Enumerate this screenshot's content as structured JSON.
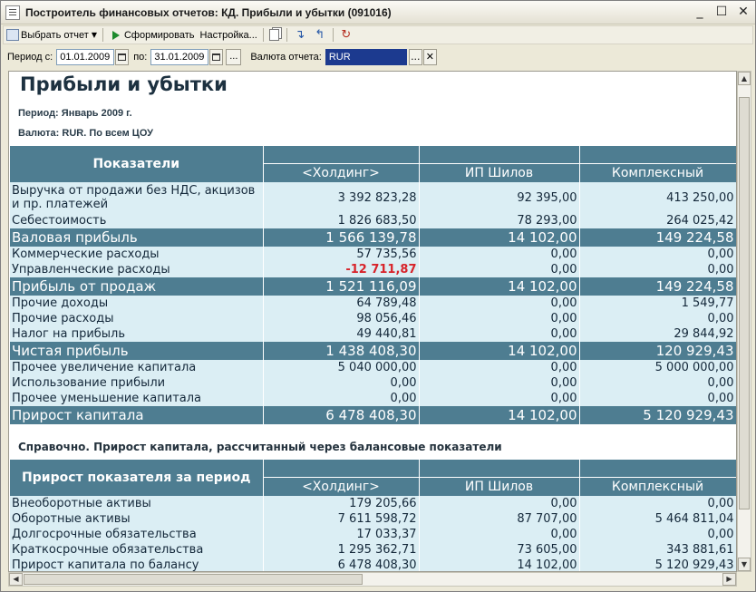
{
  "window": {
    "title": "Построитель финансовых отчетов: КД. Прибыли и убытки (091016)",
    "buttons": {
      "minimize": "_",
      "maximize": "☐",
      "close": "✕"
    }
  },
  "toolbar": {
    "select_report": "Выбрать отчет",
    "generate": "Сформировать",
    "settings": "Настройка..."
  },
  "period": {
    "from_label": "Период с:",
    "from_value": "01.01.2009",
    "to_label": "по:",
    "to_value": "31.01.2009",
    "currency_label": "Валюта отчета:",
    "currency_value": "RUR",
    "dots": "...",
    "clear": "✕"
  },
  "report": {
    "title": "Прибыли и убытки",
    "period_line": "Период: Январь 2009 г.",
    "currency_line": "Валюта: RUR.  По всем ЦОУ",
    "columns": [
      "Показатели",
      "<Холдинг>",
      "ИП Шилов",
      "Комплексный"
    ],
    "rows": [
      {
        "label": "Выручка от продажи без НДС, акцизов и пр. платежей",
        "v1": "3 392 823,28",
        "v2": "92 395,00",
        "v3": "413 250,00",
        "kind": "row2"
      },
      {
        "label": "Себестоимость",
        "v1": "1 826 683,50",
        "v2": "78 293,00",
        "v3": "264 025,42",
        "kind": "row"
      },
      {
        "label": "Валовая прибыль",
        "v1": "1 566 139,78",
        "v2": "14 102,00",
        "v3": "149 224,58",
        "kind": "total"
      },
      {
        "label": "Коммерческие расходы",
        "v1": "57 735,56",
        "v2": "0,00",
        "v3": "0,00",
        "kind": "row"
      },
      {
        "label": "Управленческие расходы",
        "v1": "-12 711,87",
        "v2": "0,00",
        "v3": "0,00",
        "kind": "row",
        "neg": true
      },
      {
        "label": "Прибыль от продаж",
        "v1": "1 521 116,09",
        "v2": "14 102,00",
        "v3": "149 224,58",
        "kind": "total"
      },
      {
        "label": "Прочие доходы",
        "v1": "64 789,48",
        "v2": "0,00",
        "v3": "1 549,77",
        "kind": "row"
      },
      {
        "label": "Прочие расходы",
        "v1": "98 056,46",
        "v2": "0,00",
        "v3": "0,00",
        "kind": "row"
      },
      {
        "label": "Налог на прибыль",
        "v1": "49 440,81",
        "v2": "0,00",
        "v3": "29 844,92",
        "kind": "row"
      },
      {
        "label": "Чистая прибыль",
        "v1": "1 438 408,30",
        "v2": "14 102,00",
        "v3": "120 929,43",
        "kind": "total"
      },
      {
        "label": "Прочее увеличение капитала",
        "v1": "5 040 000,00",
        "v2": "0,00",
        "v3": "5 000 000,00",
        "kind": "row"
      },
      {
        "label": "Использование прибыли",
        "v1": "0,00",
        "v2": "0,00",
        "v3": "0,00",
        "kind": "row"
      },
      {
        "label": "Прочее уменьшение капитала",
        "v1": "0,00",
        "v2": "0,00",
        "v3": "0,00",
        "kind": "row"
      },
      {
        "label": "Прирост капитала",
        "v1": "6 478 408,30",
        "v2": "14 102,00",
        "v3": "5 120 929,43",
        "kind": "total"
      }
    ],
    "note": "Справочно. Прирост капитала, рассчитанный через балансовые показатели",
    "columns2": [
      "Прирост показателя за период",
      "<Холдинг>",
      "ИП Шилов",
      "Комплексный"
    ],
    "rows2": [
      {
        "label": "Внеоборотные активы",
        "v1": "179 205,66",
        "v2": "0,00",
        "v3": "0,00"
      },
      {
        "label": "Оборотные активы",
        "v1": "7 611 598,72",
        "v2": "87 707,00",
        "v3": "5 464 811,04"
      },
      {
        "label": "Долгосрочные обязательства",
        "v1": "17 033,37",
        "v2": "0,00",
        "v3": "0,00"
      },
      {
        "label": "Краткосрочные обязательства",
        "v1": "1 295 362,71",
        "v2": "73 605,00",
        "v3": "343 881,61"
      },
      {
        "label": "Прирост капитала по балансу",
        "v1": "6 478 408,30",
        "v2": "14 102,00",
        "v3": "5 120 929,43"
      }
    ]
  }
}
